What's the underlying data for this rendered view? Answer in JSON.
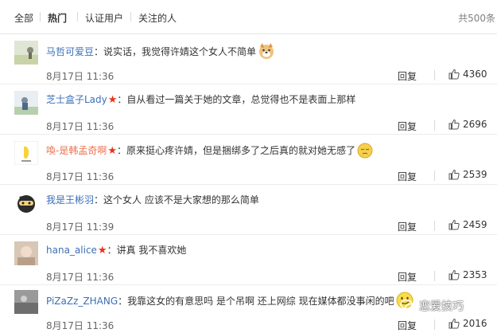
{
  "tabs": [
    {
      "label": "全部"
    },
    {
      "label": "热门"
    },
    {
      "label": "认证用户"
    },
    {
      "label": "关注的人"
    }
  ],
  "total_label": "共500条",
  "reply_label": "回复",
  "comments": [
    {
      "user": "马哲可爱豆",
      "text": "：说实话，我觉得许婧这个女人不简单",
      "time": "8月17日 11:36",
      "likes": "4360",
      "emoji": "dog-face-emoji",
      "verified": false
    },
    {
      "user": "芝士盒子Lady",
      "text": "：自从看过一篇关于她的文章，总觉得也不是表面上那样",
      "time": "8月17日 11:36",
      "likes": "2696",
      "verified": true
    },
    {
      "user": "喚-是韩孟奇啊",
      "text": "：原来挺心疼许婧，但是捆绑多了之后真的就对她无感了",
      "time": "8月17日 11:36",
      "likes": "2539",
      "emoji": "pensive-face-emoji",
      "verified": true
    },
    {
      "user": "我是王彬羽",
      "text": "：这个女人 应该不是大家想的那么简单",
      "time": "8月17日 11:39",
      "likes": "2459",
      "verified": false
    },
    {
      "user": "hana_alice",
      "text": "：讲真 我不喜欢她",
      "time": "8月17日 11:36",
      "likes": "2353",
      "verified": true
    },
    {
      "user": "PiZaZz_ZHANG",
      "text": "：我靠这女的有意思吗 是个吊啊 还上网综 现在媒体都没事闲的吧",
      "time": "8月17日 11:36",
      "likes": "2016",
      "emoji": "smile-face-emoji",
      "verified": false
    }
  ],
  "watermark": "恋爱技巧",
  "colors": {
    "username": "#eb7350",
    "username_alt": "#3b6fb6",
    "verified_star": "#e8321c"
  }
}
